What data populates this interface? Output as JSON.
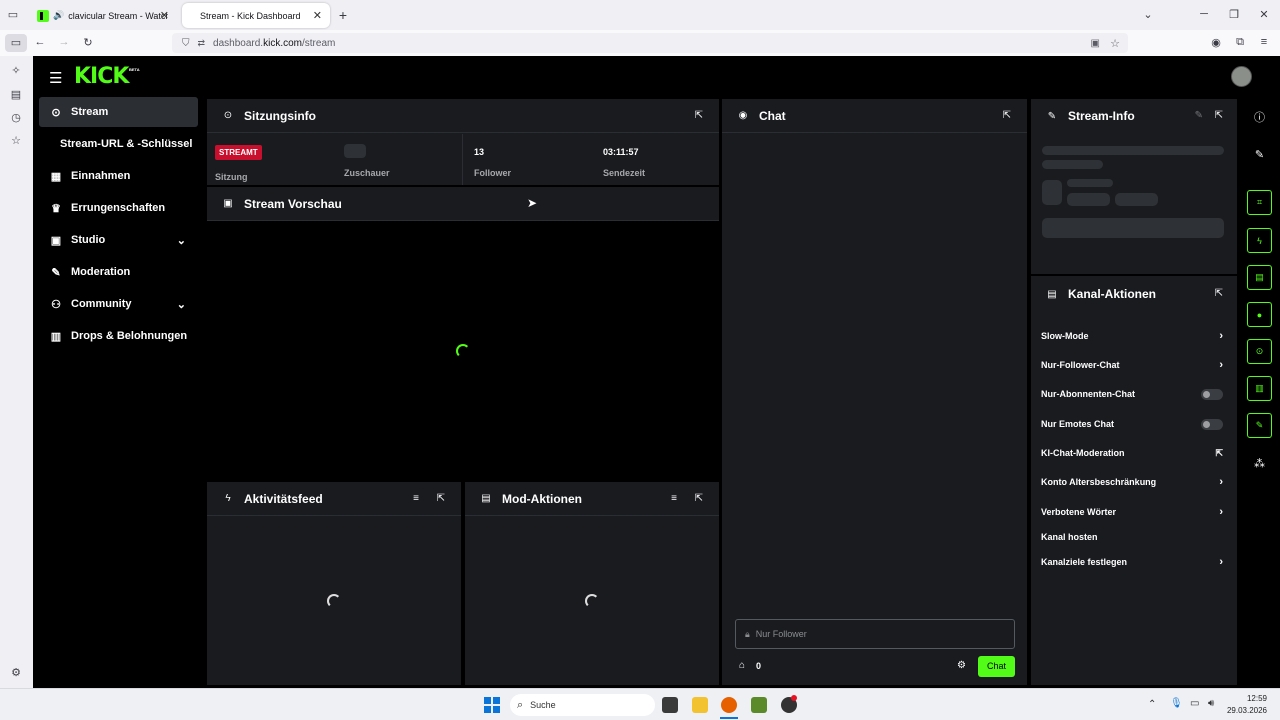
{
  "browser": {
    "tabs": [
      {
        "title": "clavicular Stream - Watch Li",
        "active": false
      },
      {
        "title": "Stream - Kick Dashboard",
        "active": true
      }
    ],
    "new_tab_symbol": "+",
    "url_prefix": "dashboard.",
    "url_domain": "kick.com",
    "url_path": "/stream"
  },
  "brand": {
    "logo": "KICK",
    "beta": "BETA",
    "accent": "#53fc18"
  },
  "nav": {
    "items": [
      {
        "label": "Stream",
        "icon": "broadcast-icon",
        "active": true
      },
      {
        "label": "Stream-URL & -Schlüssel",
        "icon": "",
        "active": false
      },
      {
        "label": "Einnahmen",
        "icon": "earnings-icon",
        "active": false
      },
      {
        "label": "Errungenschaften",
        "icon": "trophy-icon",
        "active": false
      },
      {
        "label": "Studio",
        "icon": "studio-icon",
        "active": false
      },
      {
        "label": "Moderation",
        "icon": "wrench-icon",
        "active": false
      },
      {
        "label": "Community",
        "icon": "community-icon",
        "active": false
      },
      {
        "label": "Drops & Belohnungen",
        "icon": "drops-icon",
        "active": false
      }
    ]
  },
  "session": {
    "title": "Sitzungsinfo",
    "badge": "STREAMT",
    "badge_label": "Sitzung",
    "viewers_label": "Zuschauer",
    "followers_value": "13",
    "followers_label": "Follower",
    "airtime_value": "03:11:57",
    "airtime_label": "Sendezeit"
  },
  "preview": {
    "title": "Stream Vorschau"
  },
  "activity": {
    "title": "Aktivitätsfeed"
  },
  "mod_actions": {
    "title": "Mod-Aktionen"
  },
  "chat": {
    "title": "Chat",
    "input_placeholder": "Nur Follower",
    "count": "0",
    "send_label": "Chat"
  },
  "stream_info": {
    "title": "Stream-Info"
  },
  "channel_actions": {
    "title": "Kanal-Aktionen",
    "items": [
      {
        "label": "Slow-Mode",
        "control": "chevron"
      },
      {
        "label": "Nur-Follower-Chat",
        "control": "chevron"
      },
      {
        "label": "Nur-Abonnenten-Chat",
        "control": "toggle",
        "on": false
      },
      {
        "label": "Nur Emotes Chat",
        "control": "toggle",
        "on": false
      },
      {
        "label": "KI-Chat-Moderation",
        "control": "external"
      },
      {
        "label": "Konto Altersbeschränkung",
        "control": "chevron"
      },
      {
        "label": "Verbotene Wörter",
        "control": "chevron"
      },
      {
        "label": "Kanal hosten",
        "control": "none"
      },
      {
        "label": "Kanalziele festlegen",
        "control": "chevron"
      }
    ]
  },
  "taskbar": {
    "search_placeholder": "Suche",
    "time": "12:59",
    "date": "29.03.2026"
  }
}
